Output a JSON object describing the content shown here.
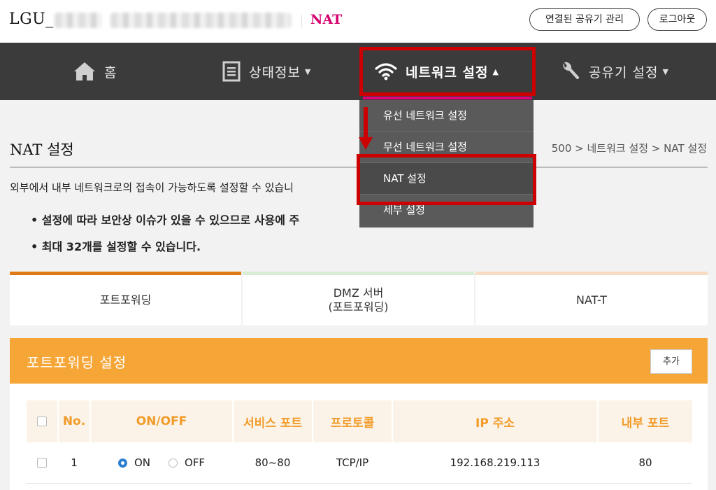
{
  "header": {
    "brand": "LGU_",
    "model": "NAT",
    "connected_devices_button": "연결된 공유기 관리",
    "logout_button": "로그아웃"
  },
  "nav": {
    "home": "홈",
    "status": "상태정보",
    "network": "네트워크 설정",
    "router": "공유기 설정"
  },
  "dropdown": {
    "items": [
      "유선 네트워크 설정",
      "무선 네트워크 설정",
      "NAT 설정",
      "세부 설정"
    ]
  },
  "page": {
    "title": "NAT 설정",
    "breadcrumb": "500 > 네트워크 설정 > NAT 설정",
    "description": "외부에서 내부 네트워크로의 접속이 가능하도록 설정할 수 있습니",
    "bullets": [
      "• 설정에 따라 보안상 이슈가 있을 수 있으므로 사용에 주",
      "• 최대 32개를 설정할 수 있습니다."
    ]
  },
  "tabs": {
    "port_forwarding": "포트포워딩",
    "dmz_line1": "DMZ 서버",
    "dmz_line2": "(포트포워딩)",
    "nat_t": "NAT-T"
  },
  "panel": {
    "title": "포트포워딩 설정",
    "add_button": "추가"
  },
  "table": {
    "headers": {
      "no": "No.",
      "onoff": "ON/OFF",
      "service_port": "서비스 포트",
      "protocol": "프로토콜",
      "ip": "IP 주소",
      "internal_port": "내부 포트"
    },
    "rows": [
      {
        "no": "1",
        "on_label": "ON",
        "off_label": "OFF",
        "state": "ON",
        "service_port": "80~80",
        "protocol": "TCP/IP",
        "ip": "192.168.219.113",
        "internal_port": "80"
      }
    ]
  },
  "colors": {
    "accent_orange": "#f6a637",
    "nav_bg": "#3b3b3b",
    "brand_magenta": "#d6006f",
    "highlight_red": "#cc0000"
  }
}
